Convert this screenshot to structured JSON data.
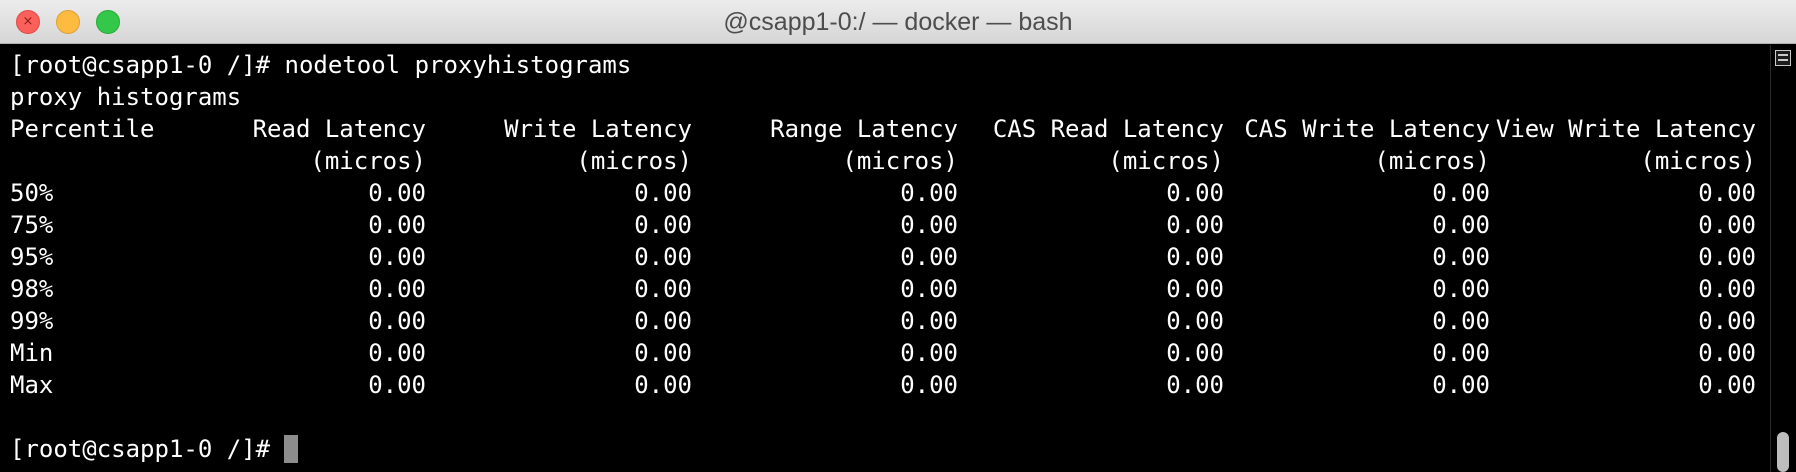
{
  "window": {
    "title": "@csapp1-0:/ — docker — bash",
    "close_glyph": "×"
  },
  "terminal": {
    "command_line": "[root@csapp1-0 /]# nodetool proxyhistograms",
    "heading": "proxy histograms",
    "headers": [
      "Percentile",
      "Read Latency",
      "Write Latency",
      "Range Latency",
      "CAS Read Latency",
      "CAS Write Latency",
      "View Write Latency"
    ],
    "units": [
      "",
      "(micros)",
      "(micros)",
      "(micros)",
      "(micros)",
      "(micros)",
      "(micros)"
    ],
    "rows": [
      [
        "50%",
        "0.00",
        "0.00",
        "0.00",
        "0.00",
        "0.00",
        "0.00"
      ],
      [
        "75%",
        "0.00",
        "0.00",
        "0.00",
        "0.00",
        "0.00",
        "0.00"
      ],
      [
        "95%",
        "0.00",
        "0.00",
        "0.00",
        "0.00",
        "0.00",
        "0.00"
      ],
      [
        "98%",
        "0.00",
        "0.00",
        "0.00",
        "0.00",
        "0.00",
        "0.00"
      ],
      [
        "99%",
        "0.00",
        "0.00",
        "0.00",
        "0.00",
        "0.00",
        "0.00"
      ],
      [
        "Min",
        "0.00",
        "0.00",
        "0.00",
        "0.00",
        "0.00",
        "0.00"
      ],
      [
        "Max",
        "0.00",
        "0.00",
        "0.00",
        "0.00",
        "0.00",
        "0.00"
      ]
    ],
    "prompt": "[root@csapp1-0 /]#"
  },
  "colors": {
    "background": "#000000",
    "text": "#ffffff",
    "cursor": "#8c8c8c",
    "close": "#fc605b",
    "minimize": "#fdbc40",
    "maximize": "#34c84a"
  },
  "icons": [
    "close-icon",
    "minimize-icon",
    "maximize-icon",
    "terminal-menu-icon"
  ]
}
